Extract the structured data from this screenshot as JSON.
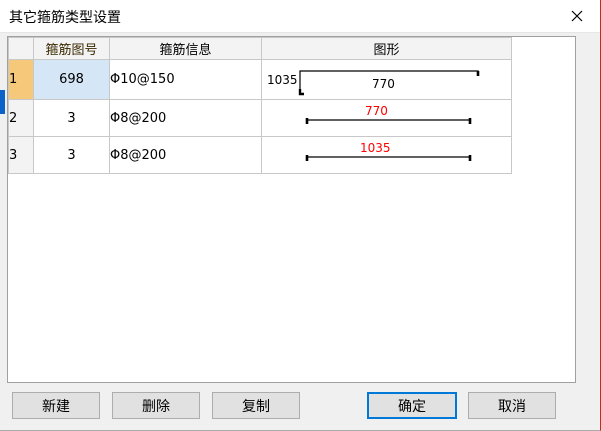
{
  "window": {
    "title": "其它箍筋类型设置"
  },
  "grid": {
    "columns": [
      "箍筋图号",
      "箍筋信息",
      "图形"
    ],
    "rows": [
      {
        "index": "1",
        "code": "698",
        "info": "Φ10@150",
        "dims": [
          "1035",
          "770"
        ]
      },
      {
        "index": "2",
        "code": "3",
        "info": "Φ8@200",
        "dims": [
          "770"
        ]
      },
      {
        "index": "3",
        "code": "3",
        "info": "Φ8@200",
        "dims": [
          "1035"
        ]
      }
    ]
  },
  "buttons": {
    "new": "新建",
    "delete": "删除",
    "copy": "复制",
    "ok": "确定",
    "cancel": "取消"
  },
  "colors": {
    "dim_red": "#ff0000",
    "selected_header": "#f6c97a",
    "selected_cell": "#d5e6f7",
    "primary_border": "#0078d7"
  },
  "icons": {
    "close": "close-icon"
  }
}
